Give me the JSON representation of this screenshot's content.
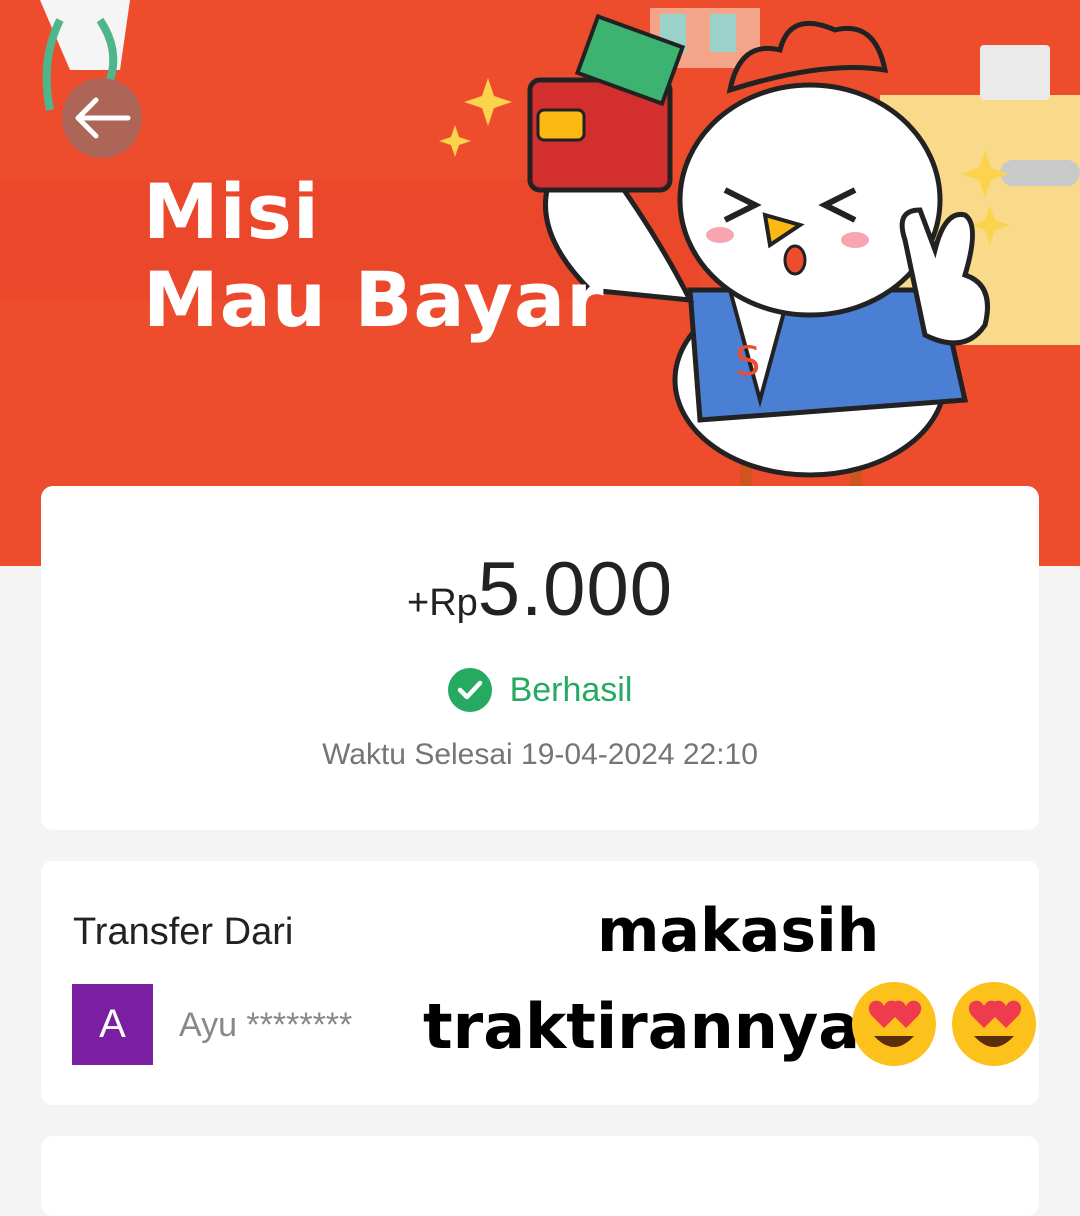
{
  "banner": {
    "title_line1": "Misi",
    "title_line2": "Mau Bayar",
    "background_color": "#ee4d2d"
  },
  "icons": {
    "back": "arrow-left-icon",
    "status": "check-circle-icon"
  },
  "transaction": {
    "amount_prefix": "+Rp",
    "amount_value": "5.000",
    "status": "Berhasil",
    "status_color": "#26aa62",
    "completed_time": "Waktu Selesai 19-04-2024 22:10"
  },
  "transfer": {
    "label": "Transfer Dari",
    "avatar_initial": "A",
    "avatar_color": "#7b1fa2",
    "sender_name": "Ayu ********"
  },
  "overlay": {
    "line1": "makasih",
    "line2": "traktirannya"
  }
}
